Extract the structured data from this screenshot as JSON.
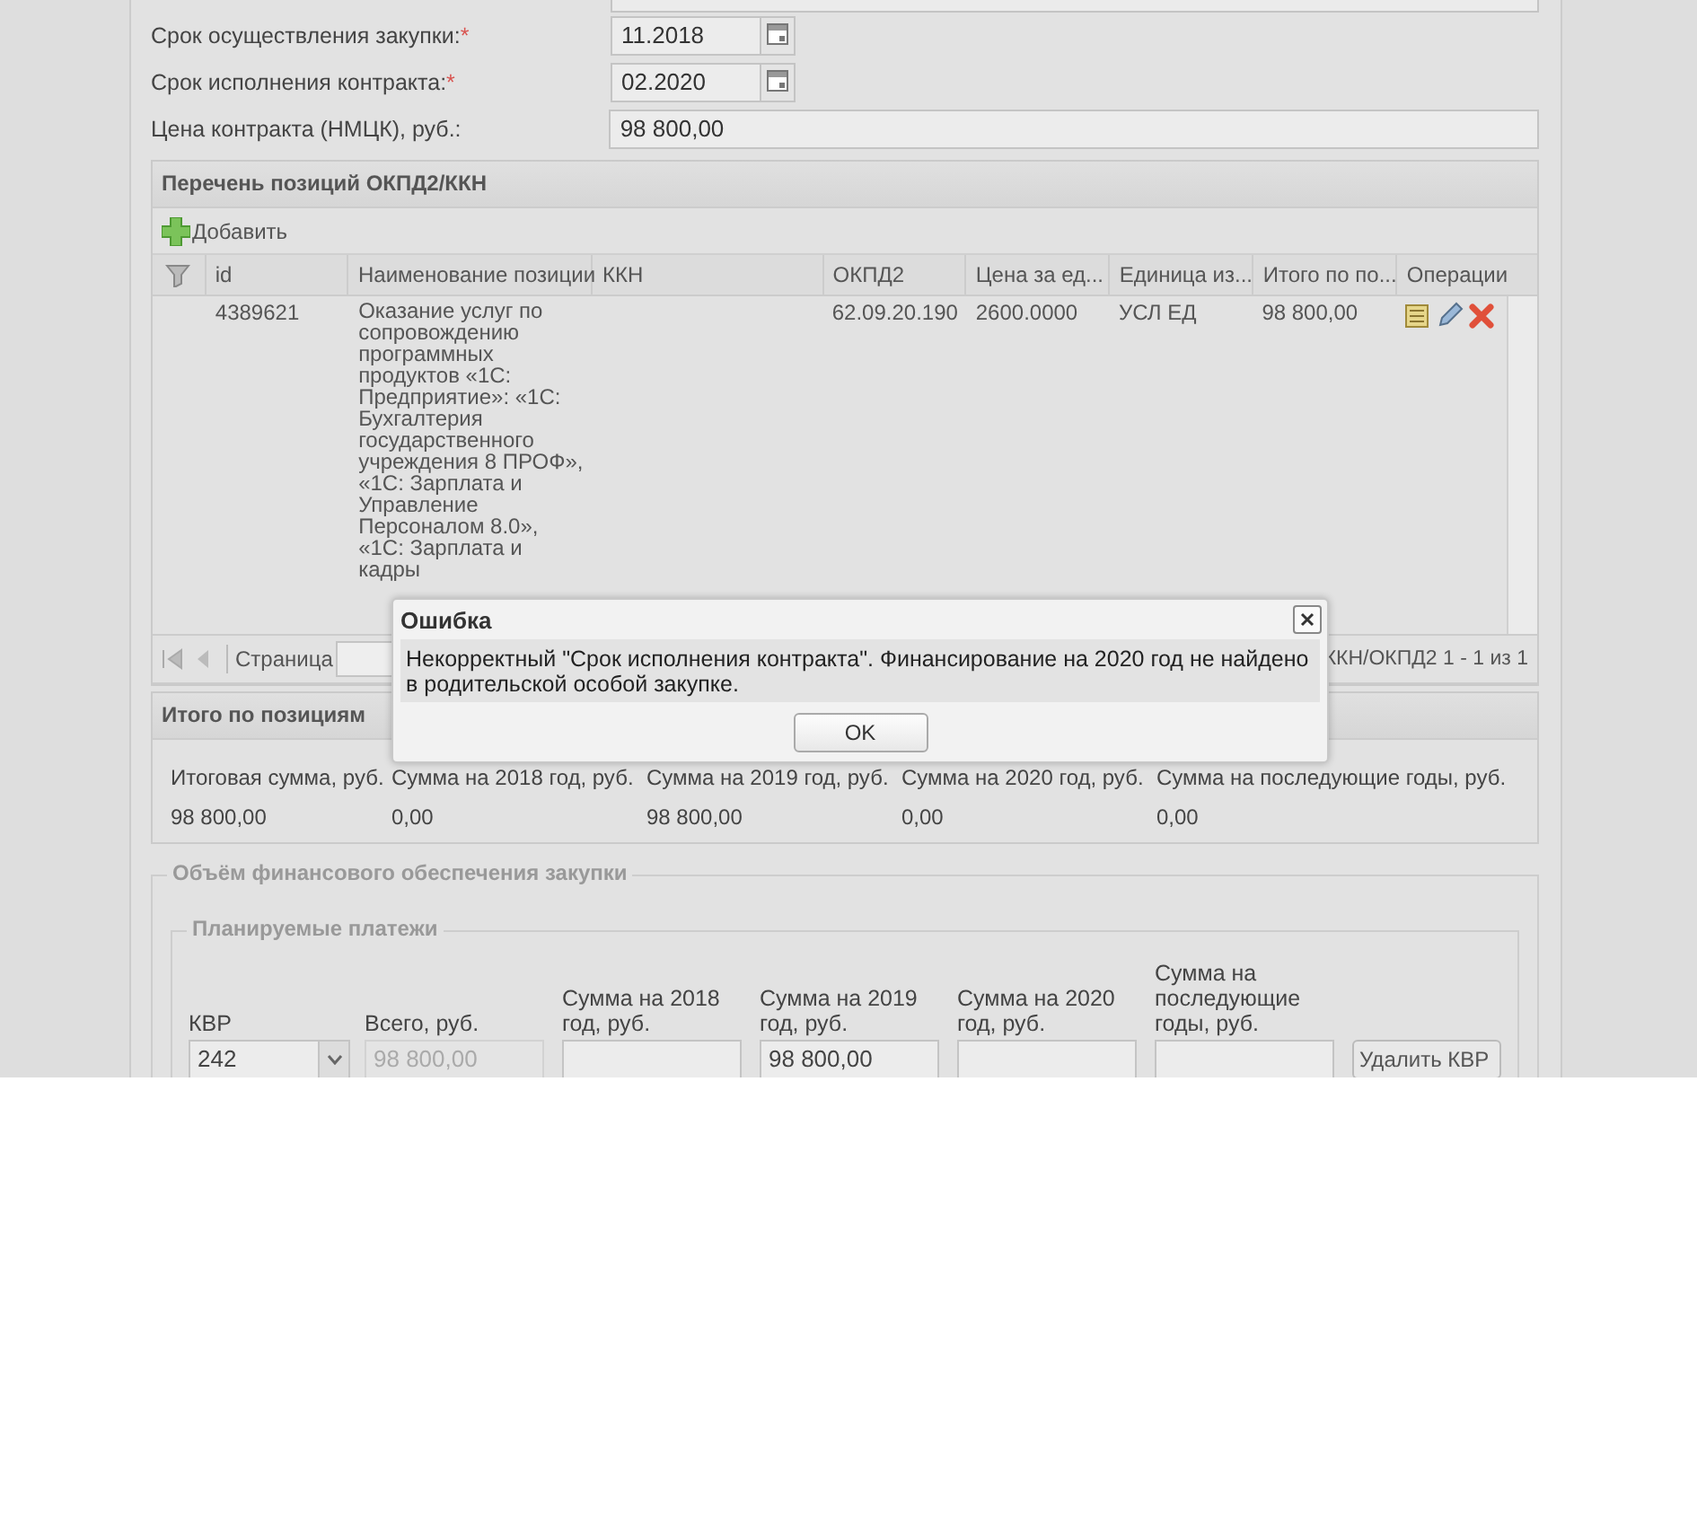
{
  "form_fields": [
    {
      "label": "Срок осуществления закупки:",
      "required_mark": "*",
      "kind": "date",
      "value": "11.2018"
    },
    {
      "label": "Срок исполнения контракта:",
      "required_mark": "*",
      "kind": "date",
      "value": "02.2020"
    },
    {
      "label": "Цена контракта (НМЦК), руб.:",
      "kind": "text",
      "value": "98 800,00"
    }
  ],
  "positions": {
    "title": "Перечень позиций ОКПД2/ККН",
    "add_button": "Добавить",
    "columns": [
      "id",
      "Наименование позиции",
      "ККН",
      "ОКПД2",
      "Цена за ед...",
      "Единица из...",
      "Итого по по...",
      "Операции"
    ],
    "rows": [
      {
        "cells": [
          "4389621",
          "Оказание услуг по сопровождению программных продуктов «1С: Предприятие»: «1С: Бухгалтерия государственного учреждения 8 ПРОФ», «1С: Зарплата и Управление Персоналом 8.0», «1С: Зарплата и кадры",
          "",
          "62.09.20.190",
          "2600.0000",
          "УСЛ ЕД",
          "98 800,00"
        ]
      }
    ],
    "pager": {
      "page_label": "Страница",
      "summary": "ККН/ОКПД2 1 - 1 из 1"
    }
  },
  "totals": {
    "title": "Итого по позициям",
    "labels": [
      "Итоговая сумма, руб.",
      "Сумма на 2018 год, руб.",
      "Сумма на 2019 год, руб.",
      "Сумма на 2020 год, руб.",
      "Сумма на последующие годы, руб."
    ],
    "values": [
      "98 800,00",
      "0,00",
      "98 800,00",
      "0,00",
      "0,00"
    ]
  },
  "financing": {
    "title": "Объём финансового обеспечения закупки",
    "payments": {
      "title": "Планируемые платежи",
      "columns": [
        "КВР",
        "Всего, руб.",
        "Сумма на 2018 год, руб.",
        "Сумма на 2019 год, руб.",
        "Сумма на 2020 год, руб.",
        "Сумма на последующие годы, руб."
      ],
      "fields": [
        {
          "kind": "select",
          "value": "242",
          "disabled": false
        },
        {
          "kind": "text",
          "value": "98 800,00",
          "disabled": true
        },
        {
          "kind": "text",
          "disabled": false
        },
        {
          "kind": "text",
          "value": "98 800,00",
          "disabled": false
        },
        {
          "kind": "text",
          "disabled": false
        },
        {
          "kind": "text",
          "disabled": false
        }
      ],
      "delete_button": "Удалить КВР"
    }
  },
  "dialog": {
    "title": "Ошибка",
    "message": "Некорректный \"Срок исполнения контракта\". Финансирование на 2020 год не найдено в родительской особой закупке.",
    "ok_button": "OK"
  }
}
